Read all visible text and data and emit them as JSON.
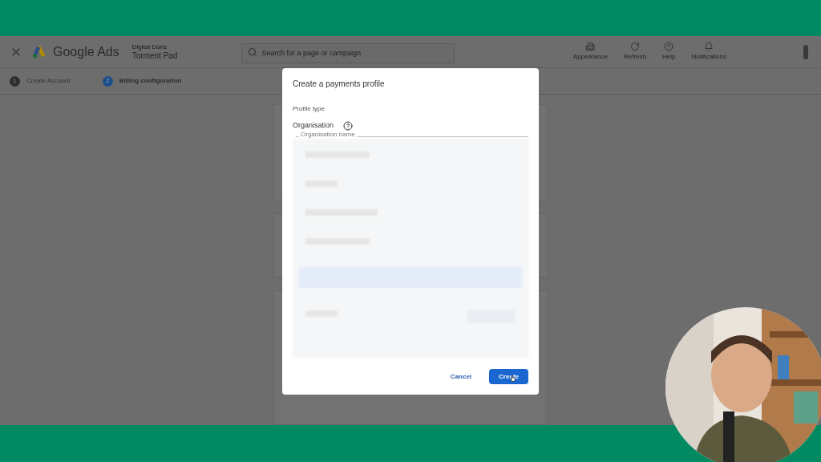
{
  "header": {
    "logo_text": "Google Ads",
    "account_parent": "Digital Darts",
    "account_name": "Torment Pad",
    "search": {
      "placeholder": "Search for a page or campaign"
    },
    "actions": [
      {
        "label": "Appearance",
        "kind": "panel"
      },
      {
        "label": "Refresh",
        "kind": "refresh"
      },
      {
        "label": "Help",
        "kind": "help"
      },
      {
        "label": "Notifications",
        "kind": "bell"
      }
    ]
  },
  "steps": [
    {
      "number": "1",
      "label": "Create Account",
      "selected": false
    },
    {
      "number": "2",
      "label": "Billing configuration",
      "selected": true
    }
  ],
  "dialog": {
    "title": "Create a payments profile",
    "profile_type_label": "Profile type",
    "profile_type": "Organisation",
    "field_label": "Organisation name",
    "buttons": [
      {
        "label": "Cancel",
        "kind": "text"
      },
      {
        "label": "Create",
        "kind": "primary"
      }
    ]
  }
}
